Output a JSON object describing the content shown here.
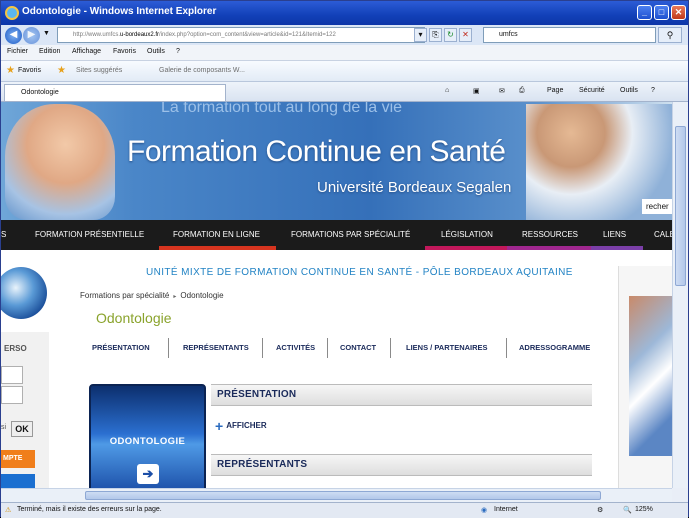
{
  "window": {
    "title": "Odontologie - Windows Internet Explorer",
    "buttons": {
      "minimize": "_",
      "maximize": "□",
      "close": "✕"
    }
  },
  "address_bar": {
    "url_prefix": "http://www.umfcs.",
    "url_domain": "u-bordeaux2.fr",
    "url_rest": "/index.php?option=com_content&view=article&id=121&Itemid=122",
    "search_value": "umfcs",
    "search_button": "⚲"
  },
  "menu": [
    "Fichier",
    "Edition",
    "Affichage",
    "Favoris",
    "Outils",
    "?"
  ],
  "favorites_bar": {
    "favorites_label": "Favoris",
    "suggested": "Sites suggérés",
    "gallery": "Galerie de composants W..."
  },
  "tab": {
    "label": "Odontologie"
  },
  "command_bar": {
    "page": "Page",
    "security": "Sécurité",
    "tools": "Outils",
    "help": "?"
  },
  "banner": {
    "ghost_text": "La formation tout au long de la vie",
    "title": "Formation Continue en Santé",
    "subtitle": "Université Bordeaux Segalen",
    "search_stub": "recher"
  },
  "main_nav": [
    {
      "label": "S",
      "bar": "#1b1b1b"
    },
    {
      "label": "FORMATION PRÉSENTIELLE",
      "bar": "#1b1b1b"
    },
    {
      "label": "FORMATION EN LIGNE",
      "bar": "#d6341f"
    },
    {
      "label": "FORMATIONS PAR SPÉCIALITÉ",
      "bar": "#1b1b1b"
    },
    {
      "label": "LÉGISLATION",
      "bar": "#c2185b"
    },
    {
      "label": "RESSOURCES",
      "bar": "#a0278f"
    },
    {
      "label": "LIENS",
      "bar": "#7b3fa8"
    },
    {
      "label": "CALE",
      "bar": "#1b1b1b"
    }
  ],
  "content": {
    "unite": "UNITÉ MIXTE DE FORMATION CONTINUE EN SANTÉ - PÔLE BORDEAUX AQUITAINE",
    "breadcrumb": {
      "parent": "Formations par spécialité",
      "separator": "▸",
      "current": "Odontologie"
    },
    "page_title": "Odontologie",
    "sub_nav": [
      "PRÉSENTATION",
      "REPRÉSENTANTS",
      "ACTIVITÉS",
      "CONTACT",
      "LIENS / PARTENAIRES",
      "ADRESSOGRAMME"
    ],
    "box_title": "ODONTOLOGIE",
    "box_arrow": "➔",
    "sections": [
      "PRÉSENTATION",
      "REPRÉSENTANTS"
    ],
    "afficher": "AFFICHER",
    "afficher_icon": "+"
  },
  "left_panel": {
    "label": "ERSO",
    "side_text": "si",
    "ok": "OK",
    "orange_btn": "MPTE"
  },
  "status_bar": {
    "message": "Terminé, mais il existe des erreurs sur la page.",
    "zone": "Internet",
    "zoom": "125%"
  }
}
